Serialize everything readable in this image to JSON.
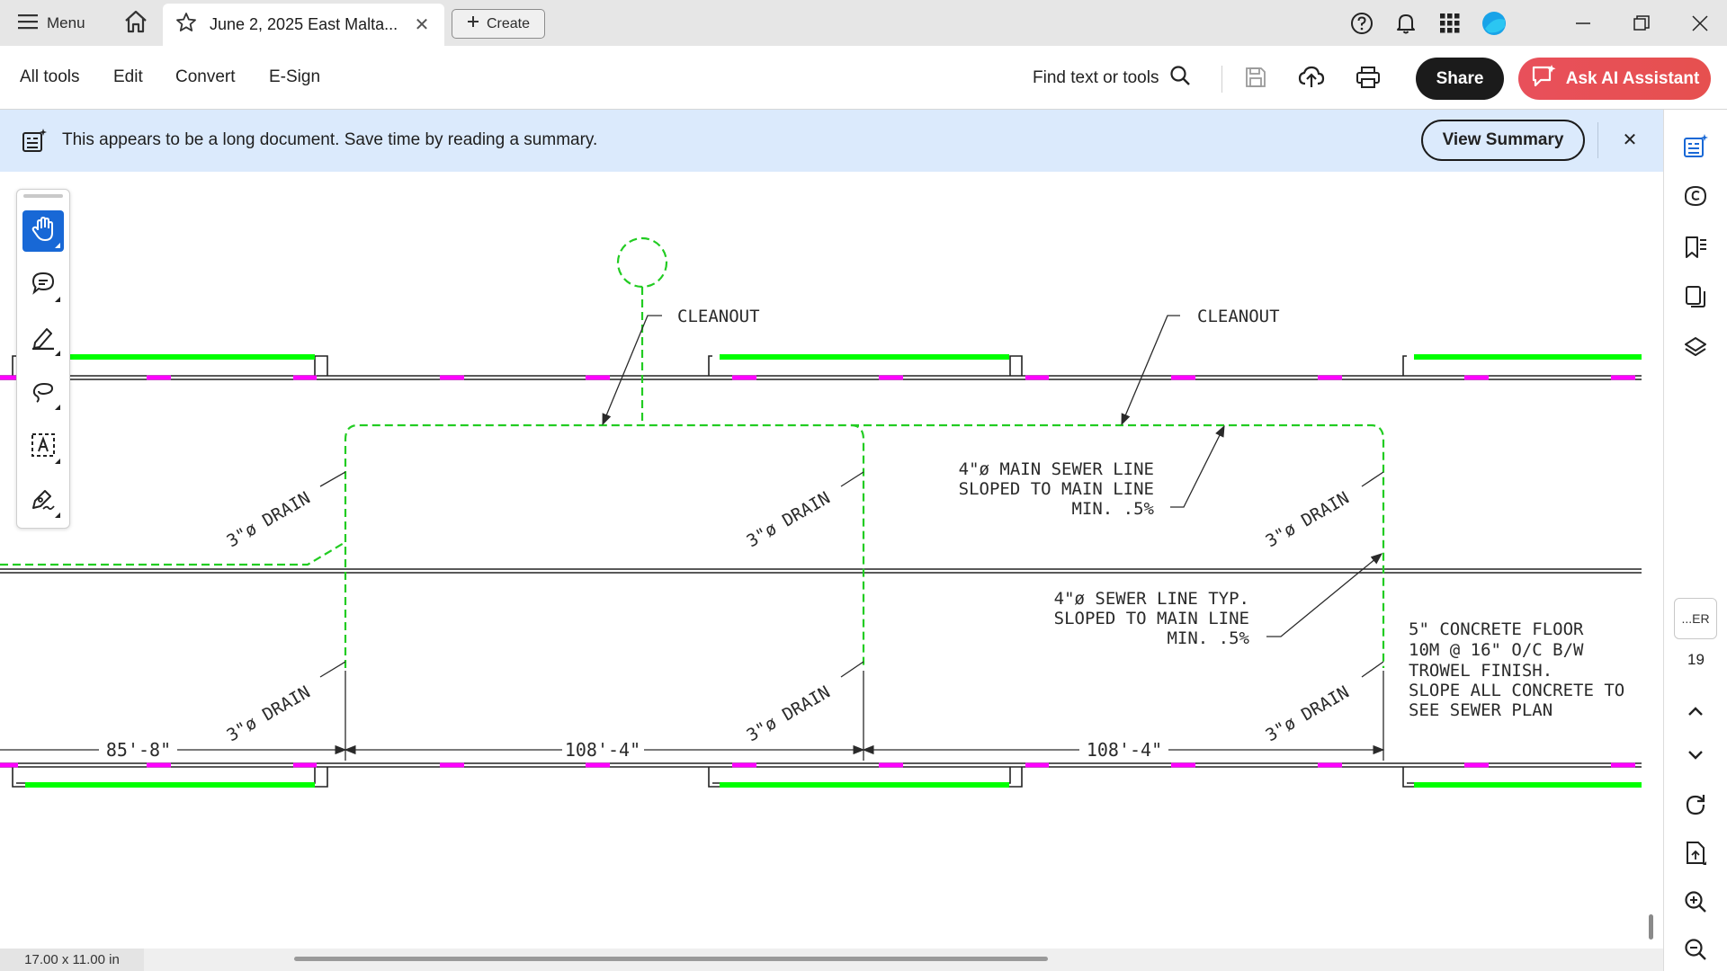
{
  "tabbar": {
    "menu_label": "Menu",
    "tab_title": "June 2, 2025 East Malta...",
    "tab_close": "✕",
    "create_label": "Create"
  },
  "toolbar": {
    "menus": [
      "All tools",
      "Edit",
      "Convert",
      "E-Sign"
    ],
    "find_label": "Find text or tools",
    "share_label": "Share",
    "ai_label": "Ask AI Assistant"
  },
  "banner": {
    "text": "This appears to be a long document. Save time by reading a summary.",
    "summary_label": "View Summary",
    "close": "✕"
  },
  "drawing": {
    "cleanout_left": "CLEANOUT",
    "cleanout_right": "CLEANOUT",
    "drain_label": "3\"ø DRAIN",
    "main_sewer": [
      "4\"ø MAIN SEWER LINE",
      "SLOPED TO MAIN LINE",
      "MIN. .5%"
    ],
    "sewer_typ": [
      "4\"ø SEWER LINE TYP.",
      "SLOPED TO MAIN LINE",
      "MIN. .5%"
    ],
    "concrete_note": [
      "5\" CONCRETE FLOOR",
      "10M @ 16\" O/C B/W",
      "TROWEL FINISH.",
      "SLOPE ALL CONCRETE TO",
      "SEE SEWER PLAN"
    ],
    "dim_1": "85'-8\"",
    "dim_2": "108'-4\"",
    "dim_3": "108'-4\""
  },
  "right_rail": {
    "page_box": "...ER",
    "page_number": "19"
  },
  "status": {
    "page_size": "17.00 x 11.00 in"
  },
  "colors": {
    "accent_blue": "#1868d6",
    "share_bg": "#1b1b1b",
    "ai_bg": "#e8505b",
    "banner_bg": "#dbeafc",
    "sewer_green": "#22cc22",
    "wall_green": "#00ff00",
    "magenta": "#ff00ff"
  }
}
